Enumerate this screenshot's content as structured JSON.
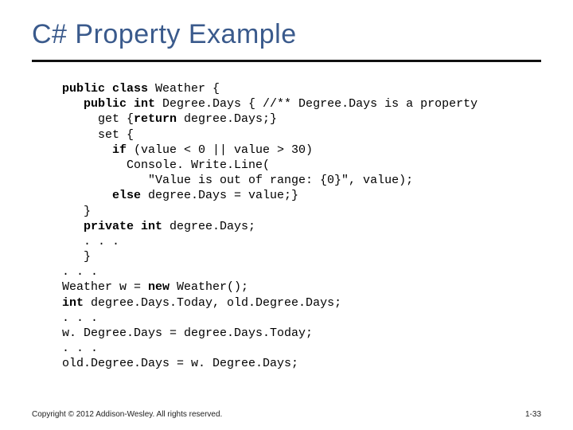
{
  "title": "C# Property Example",
  "code": {
    "line01a": "public class",
    "line01b": " Weather {",
    "line02a": "   public int",
    "line02b": " Degree.Days { //** Degree.Days is a property",
    "line03a": "     get {",
    "line03b": "return",
    "line03c": " degree.Days;}",
    "line04": "     set {",
    "line05a": "       if",
    "line05b": " (value < 0 || value > 30)",
    "line06": "         Console. Write.Line(",
    "line07": "            \"Value is out of range: {0}\", value);",
    "line08a": "       else",
    "line08b": " degree.Days = value;}",
    "line09": "   }",
    "line10a": "   private int",
    "line10b": " degree.Days;",
    "line11": "   . . .",
    "line12": "   }",
    "line13": ". . .",
    "line14a": "Weather w = ",
    "line14b": "new",
    "line14c": " Weather();",
    "line15a": "int",
    "line15b": " degree.Days.Today, old.Degree.Days;",
    "line16": ". . .",
    "line17": "w. Degree.Days = degree.Days.Today;",
    "line18": ". . .",
    "line19": "old.Degree.Days = w. Degree.Days;"
  },
  "footer": {
    "copyright": "Copyright © 2012 Addison-Wesley. All rights reserved.",
    "page": "1-33"
  }
}
